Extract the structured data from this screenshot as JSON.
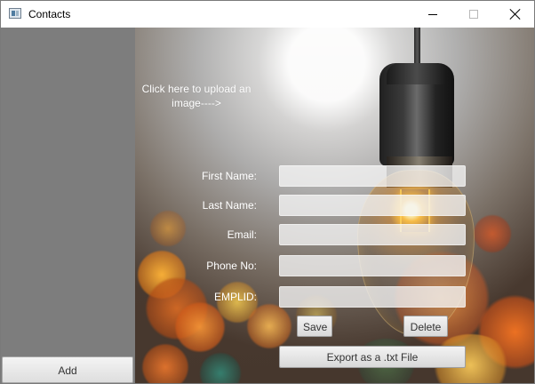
{
  "window": {
    "title": "Contacts",
    "icon": "application-window-icon",
    "controls": {
      "minimize": "minimize-icon",
      "maximize": "maximize-icon",
      "close": "close-icon"
    }
  },
  "sidebar": {
    "add_label": "Add"
  },
  "upload": {
    "label": "Click here to upload an image---->"
  },
  "form": {
    "fields": [
      {
        "label": "First Name:",
        "value": "",
        "placeholder": ""
      },
      {
        "label": "Last Name:",
        "value": "",
        "placeholder": ""
      },
      {
        "label": "Email:",
        "value": "",
        "placeholder": ""
      },
      {
        "label": "Phone No:",
        "value": "",
        "placeholder": ""
      },
      {
        "label": "EMPLID:",
        "value": "",
        "placeholder": ""
      }
    ]
  },
  "actions": {
    "save_label": "Save",
    "delete_label": "Delete",
    "export_label": "Export as a .txt File"
  },
  "colors": {
    "sidebar": "#7d7d7d",
    "text_on_photo": "#ffffff",
    "button_text": "#333333"
  }
}
